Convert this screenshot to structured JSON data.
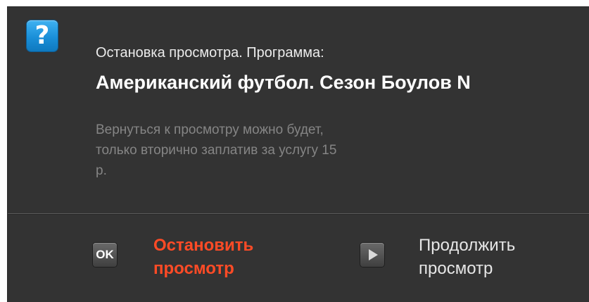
{
  "dialog": {
    "icon": "question-icon",
    "icon_glyph": "?",
    "subtitle": "Остановка просмотра. Программа:",
    "program_title": "Американский футбол. Сезон Боулов N",
    "notice_line1": "Вернуться к просмотру можно будет,",
    "notice_line2": "только вторично заплатив за услугу 15",
    "notice_line3": "р."
  },
  "actions": {
    "stop": {
      "key_icon": "ok-key-icon",
      "key_label": "OK",
      "label_line1": "Остановить",
      "label_line2": "просмотр",
      "color": "#ff4b26"
    },
    "continue": {
      "key_icon": "play-key-icon",
      "label_line1": "Продолжить",
      "label_line2": "просмотр"
    }
  },
  "colors": {
    "background": "#333333",
    "accent_icon": "#1a8fd8",
    "notice_text": "#858585"
  }
}
